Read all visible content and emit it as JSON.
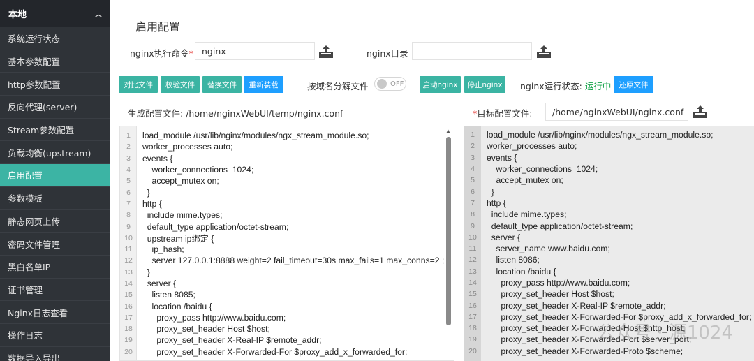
{
  "sidebar": {
    "group_label": "本地",
    "items": [
      {
        "label": "系统运行状态"
      },
      {
        "label": "基本参数配置"
      },
      {
        "label": "http参数配置"
      },
      {
        "label": "反向代理(server)"
      },
      {
        "label": "Stream参数配置"
      },
      {
        "label": "负载均衡(upstream)"
      },
      {
        "label": "启用配置"
      },
      {
        "label": "参数模板"
      },
      {
        "label": "静态网页上传"
      },
      {
        "label": "密码文件管理"
      },
      {
        "label": "黑白名单IP"
      },
      {
        "label": "证书管理"
      },
      {
        "label": "Nginx日志查看"
      },
      {
        "label": "操作日志"
      },
      {
        "label": "数据导入导出"
      }
    ]
  },
  "page": {
    "title": "启用配置",
    "exec_label": "nginx执行命令",
    "exec_required": "*",
    "exec_value": "nginx",
    "dir_label": "nginx目录",
    "dir_value": "",
    "buttons": {
      "compare": "对比文件",
      "check": "校验文件",
      "replace": "替换文件",
      "reload": "重新装载",
      "start": "启动nginx",
      "stop": "停止nginx",
      "restore": "还原文件"
    },
    "split_label": "按域名分解文件",
    "toggle_text": "OFF",
    "status_label": "nginx运行状态:",
    "status_value": "运行中",
    "gen_file_label": "生成配置文件:",
    "gen_file_path": "/home/nginxWebUI/temp/nginx.conf",
    "target_required": "*",
    "target_label": "目标配置文件:",
    "target_value": "/home/nginxWebUI/nginx.conf"
  },
  "left_code": [
    {
      "n": "1",
      "t": "load_module /usr/lib/nginx/modules/ngx_stream_module.so;"
    },
    {
      "n": "2",
      "t": "worker_processes auto;"
    },
    {
      "n": "3",
      "t": "events {"
    },
    {
      "n": "4",
      "t": "    worker_connections  1024;"
    },
    {
      "n": "5",
      "t": "    accept_mutex on;"
    },
    {
      "n": "6",
      "t": "  }"
    },
    {
      "n": "7",
      "t": "http {"
    },
    {
      "n": "8",
      "t": "  include mime.types;"
    },
    {
      "n": "9",
      "t": "  default_type application/octet-stream;"
    },
    {
      "n": "10",
      "t": "  upstream ip绑定 {"
    },
    {
      "n": "11",
      "t": "    ip_hash;"
    },
    {
      "n": "12",
      "t": "    server 127.0.0.1:8888 weight=2 fail_timeout=30s max_fails=1 max_conns=2 ;"
    },
    {
      "n": "13",
      "t": "  }"
    },
    {
      "n": "14",
      "t": "  server {"
    },
    {
      "n": "15",
      "t": "    listen 8085;"
    },
    {
      "n": "16",
      "t": "    location /baidu {"
    },
    {
      "n": "17",
      "t": "      proxy_pass http://www.baidu.com;"
    },
    {
      "n": "18",
      "t": "      proxy_set_header Host $host;"
    },
    {
      "n": "19",
      "t": "      proxy_set_header X-Real-IP $remote_addr;"
    },
    {
      "n": "20",
      "t": "      proxy_set_header X-Forwarded-For $proxy_add_x_forwarded_for;"
    }
  ],
  "right_code": [
    {
      "n": "1",
      "t": "load_module /usr/lib/nginx/modules/ngx_stream_module.so;"
    },
    {
      "n": "2",
      "t": "worker_processes auto;"
    },
    {
      "n": "3",
      "t": "events {"
    },
    {
      "n": "4",
      "t": "    worker_connections  1024;"
    },
    {
      "n": "5",
      "t": "    accept_mutex on;"
    },
    {
      "n": "6",
      "t": "  }"
    },
    {
      "n": "7",
      "t": "http {"
    },
    {
      "n": "8",
      "t": "  include mime.types;"
    },
    {
      "n": "9",
      "t": "  default_type application/octet-stream;"
    },
    {
      "n": "10",
      "t": "  server {"
    },
    {
      "n": "11",
      "t": "    server_name www.baidu.com;"
    },
    {
      "n": "12",
      "t": "    listen 8086;"
    },
    {
      "n": "13",
      "t": "    location /baidu {"
    },
    {
      "n": "14",
      "t": "      proxy_pass http://www.baidu.com;"
    },
    {
      "n": "15",
      "t": "      proxy_set_header Host $host;"
    },
    {
      "n": "16",
      "t": "      proxy_set_header X-Real-IP $remote_addr;"
    },
    {
      "n": "17",
      "t": "      proxy_set_header X-Forwarded-For $proxy_add_x_forwarded_for;"
    },
    {
      "n": "18",
      "t": "      proxy_set_header X-Forwarded-Host $http_host;"
    },
    {
      "n": "19",
      "t": "      proxy_set_header X-Forwarded-Port $server_port;"
    },
    {
      "n": "20",
      "t": "      proxy_set_header X-Forwarded-Proto $scheme;"
    }
  ],
  "watermark": "公众号 · 源1024",
  "colors": {
    "accent": "#3bb4a3",
    "blue": "#1e9fff",
    "status_green": "#16a34a",
    "sidebar_bg": "#2f3338"
  }
}
